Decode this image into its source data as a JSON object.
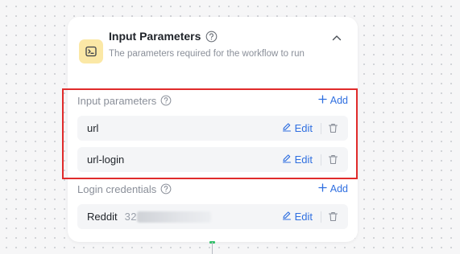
{
  "card": {
    "title": "Input Parameters",
    "subtitle": "The parameters required for the workflow to run"
  },
  "input_parameters": {
    "label": "Input parameters",
    "add_label": "Add",
    "items": [
      {
        "name": "url",
        "edit_label": "Edit"
      },
      {
        "name": "url-login",
        "edit_label": "Edit"
      }
    ]
  },
  "login_credentials": {
    "label": "Login credentials",
    "add_label": "Add",
    "items": [
      {
        "name": "Reddit",
        "number_visible": "32",
        "edit_label": "Edit"
      }
    ]
  },
  "colors": {
    "accent": "#2f6fe0",
    "highlight_border": "#e02b2b",
    "icon_badge": "#fbe8a6",
    "connector_dot": "#34c26b"
  }
}
